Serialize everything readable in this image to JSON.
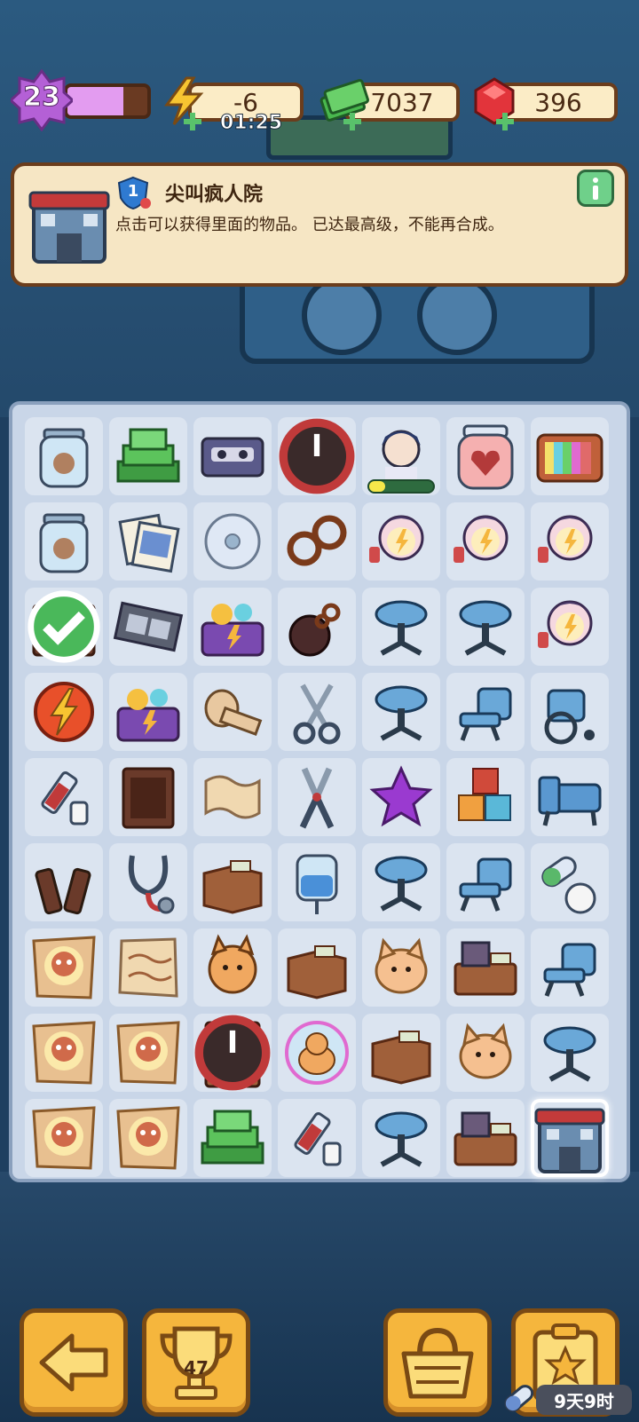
{
  "hud": {
    "level": "23",
    "level_progress": 0.7,
    "energy": "-6",
    "energy_timer": "01:25",
    "cash": "7037",
    "gems": "396"
  },
  "info": {
    "shield_level": "1",
    "title": "尖叫疯人院",
    "description": "点击可以获得里面的物品。 已达最高级，不能再合成。"
  },
  "board": {
    "cells": [
      "jar-icon",
      "cash-pile-icon",
      "cassette-icon",
      "bandaged-girl-icon",
      "patient-boy-icon",
      "heart-jar-icon",
      "tv-icon",
      "jar-icon",
      "photos-icon",
      "cd-icon",
      "handcuffs-icon",
      "ghost-nurse-icon",
      "ghost-nurse-icon",
      "ghost-nurse-icon",
      "cage-icon",
      "film-strip-icon",
      "toy-chest-icon",
      "ball-chain-icon",
      "stool-icon",
      "stool-icon",
      "ghost-nurse-icon",
      "energy-orb-icon",
      "toy-chest-icon",
      "bandage-roll-icon",
      "scissors-icon",
      "stool-icon",
      "chair-icon",
      "wheelchair-icon",
      "syringe-icon",
      "wooden-box-icon",
      "paper-icon",
      "pliers-icon",
      "purple-star-icon",
      "blocks-icon",
      "bed-icon",
      "bottles-icon",
      "stethoscope-icon",
      "cardboard-box-icon",
      "iv-bag-icon",
      "stool-icon",
      "chair-icon",
      "pills-icon",
      "skull-paper-icon",
      "note-paper-icon",
      "cat-toy-icon",
      "cardboard-box-icon",
      "cat-face-icon",
      "desk-icon",
      "chair-icon",
      "skull-paper-icon",
      "skull-paper-icon",
      "elevator-icon",
      "cat-bubble-icon",
      "cardboard-box-icon",
      "cat-face-icon",
      "stool-icon",
      "skull-paper-icon",
      "skull-paper-icon",
      "cash-pile-icon",
      "syringe-icon",
      "stool-icon",
      "desk-icon",
      "asylum-icon"
    ],
    "patient_progress": 0.25
  },
  "bottom": {
    "trophy_count": "47",
    "time_left": "9天9时"
  },
  "colors": {
    "accent": "#f5b63d",
    "panel": "#f6e6c4",
    "board": "#c9d6e8"
  }
}
